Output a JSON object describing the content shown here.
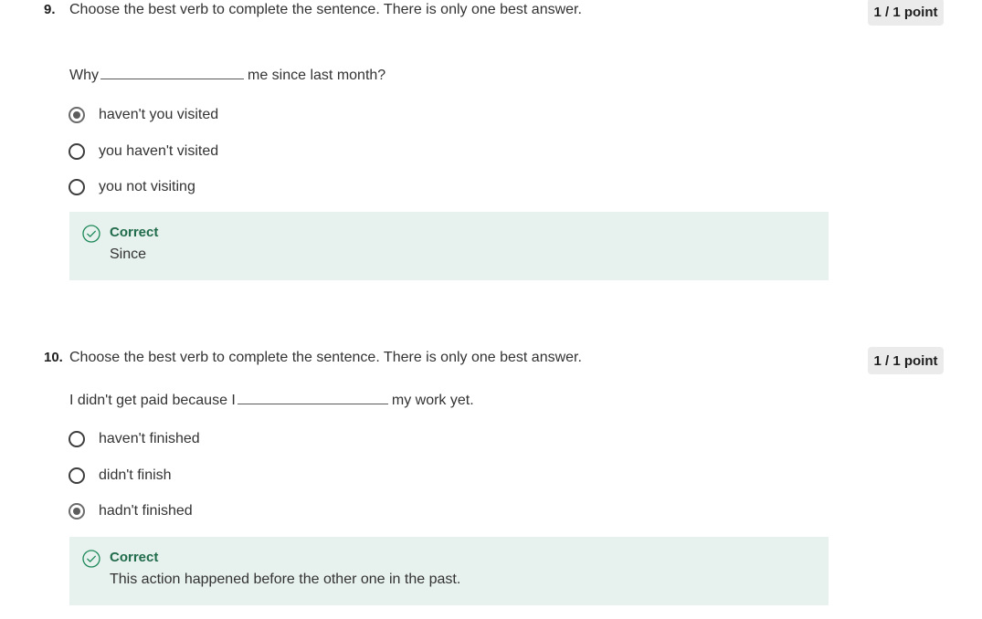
{
  "questions": [
    {
      "number": "9.",
      "prompt": "Choose the best verb to complete the sentence. There is only one best answer.",
      "points": "1 / 1 point",
      "sentence_before": "Why",
      "sentence_after": "me since last month?",
      "options": [
        {
          "label": "haven't you visited",
          "selected": true
        },
        {
          "label": "you haven't visited",
          "selected": false
        },
        {
          "label": "you not visiting",
          "selected": false
        }
      ],
      "feedback": {
        "title": "Correct",
        "text": "Since"
      }
    },
    {
      "number": "10.",
      "prompt": "Choose the best verb to complete the sentence. There is only one best answer.",
      "points": "1 / 1 point",
      "sentence_before": "I didn't get paid because I",
      "sentence_after": "my work yet.",
      "options": [
        {
          "label": "haven't finished",
          "selected": false
        },
        {
          "label": "didn't finish",
          "selected": false
        },
        {
          "label": "hadn't finished",
          "selected": true
        }
      ],
      "feedback": {
        "title": "Correct",
        "text": "This action happened before the other one in the past."
      }
    }
  ],
  "colors": {
    "feedback_bg": "#e7f1ee",
    "correct_green": "#1f6b4a",
    "badge_bg": "#ebebeb"
  },
  "icons": {
    "feedback": "check-circle-icon"
  }
}
